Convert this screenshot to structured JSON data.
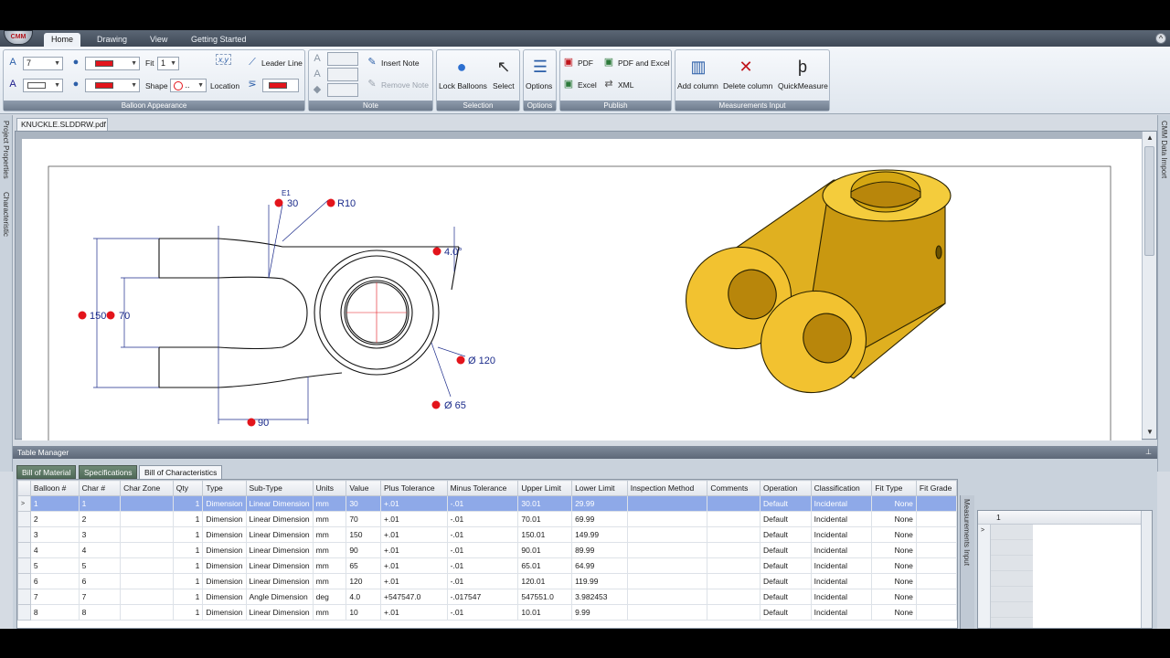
{
  "app": {
    "logo_text": "CMM"
  },
  "tabs": [
    "Home",
    "Drawing",
    "View",
    "Getting Started"
  ],
  "ribbon": {
    "balloon_appearance": {
      "label": "Balloon Appearance",
      "font_size": "7",
      "fit_label": "Fit",
      "fit_value": "1",
      "shape_label": "Shape",
      "shape_value": "..",
      "location_label": "Location",
      "location_icon_text": "x,y",
      "leader_line_label": "Leader Line"
    },
    "note": {
      "label": "Note",
      "insert_note": "Insert Note",
      "remove_note": "Remove Note"
    },
    "selection": {
      "label": "Selection",
      "lock_balloons": "Lock Balloons",
      "select": "Select"
    },
    "options": {
      "label": "Options",
      "options": "Options"
    },
    "publish": {
      "label": "Publish",
      "pdf": "PDF",
      "pdf_and_excel": "PDF and Excel",
      "excel": "Excel",
      "xml": "XML"
    },
    "measurements_input": {
      "label": "Measurements Input",
      "add_column": "Add column",
      "delete_column": "Delete column",
      "quick_measure": "QuickMeasure"
    }
  },
  "side_panels": {
    "left": [
      "Project Properties",
      "Characteristic"
    ],
    "right": "CMM Data Import"
  },
  "document": {
    "tab": "KNUCKLE.SLDDRW.pdf",
    "dims": {
      "d30": "30",
      "r10": "R10",
      "a4": "4.0°",
      "d150": "150",
      "d70": "70",
      "d120": "Ø 120",
      "d65": "Ø 65",
      "d90": "90",
      "flag": "E1"
    }
  },
  "table_manager": {
    "title": "Table Manager",
    "pin": "⊥",
    "subtabs": [
      "Bill of Material",
      "Specifications",
      "Bill of Characteristics"
    ],
    "columns": [
      "Balloon #",
      "Char #",
      "Char Zone",
      "Qty",
      "Type",
      "Sub-Type",
      "Units",
      "Value",
      "Plus Tolerance",
      "Minus Tolerance",
      "Upper Limit",
      "Lower Limit",
      "Inspection Method",
      "Comments",
      "Operation",
      "Classification",
      "Fit Type",
      "Fit Grade"
    ],
    "rows": [
      [
        "1",
        "1",
        "",
        "1",
        "Dimension",
        "Linear Dimension",
        "mm",
        "30",
        "+.01",
        "-.01",
        "30.01",
        "29.99",
        "",
        "",
        "Default",
        "Incidental",
        "None",
        ""
      ],
      [
        "2",
        "2",
        "",
        "1",
        "Dimension",
        "Linear Dimension",
        "mm",
        "70",
        "+.01",
        "-.01",
        "70.01",
        "69.99",
        "",
        "",
        "Default",
        "Incidental",
        "None",
        ""
      ],
      [
        "3",
        "3",
        "",
        "1",
        "Dimension",
        "Linear Dimension",
        "mm",
        "150",
        "+.01",
        "-.01",
        "150.01",
        "149.99",
        "",
        "",
        "Default",
        "Incidental",
        "None",
        ""
      ],
      [
        "4",
        "4",
        "",
        "1",
        "Dimension",
        "Linear Dimension",
        "mm",
        "90",
        "+.01",
        "-.01",
        "90.01",
        "89.99",
        "",
        "",
        "Default",
        "Incidental",
        "None",
        ""
      ],
      [
        "5",
        "5",
        "",
        "1",
        "Dimension",
        "Linear Dimension",
        "mm",
        "65",
        "+.01",
        "-.01",
        "65.01",
        "64.99",
        "",
        "",
        "Default",
        "Incidental",
        "None",
        ""
      ],
      [
        "6",
        "6",
        "",
        "1",
        "Dimension",
        "Linear Dimension",
        "mm",
        "120",
        "+.01",
        "-.01",
        "120.01",
        "119.99",
        "",
        "",
        "Default",
        "Incidental",
        "None",
        ""
      ],
      [
        "7",
        "7",
        "",
        "1",
        "Dimension",
        "Angle Dimension",
        "deg",
        "4.0",
        "+547547.0",
        "-.017547",
        "547551.0",
        "3.982453",
        "",
        "",
        "Default",
        "Incidental",
        "None",
        ""
      ],
      [
        "8",
        "8",
        "",
        "1",
        "Dimension",
        "Linear Dimension",
        "mm",
        "10",
        "+.01",
        "-.01",
        "10.01",
        "9.99",
        "",
        "",
        "Default",
        "Incidental",
        "None",
        ""
      ]
    ],
    "selected_row": 0,
    "measurements_panel_label": "Measurements Input",
    "measurements_column": "1"
  },
  "colors": {
    "accent_red": "#e3141b",
    "part_yellow": "#f2c230",
    "selection_blue": "#8ea9e8"
  }
}
